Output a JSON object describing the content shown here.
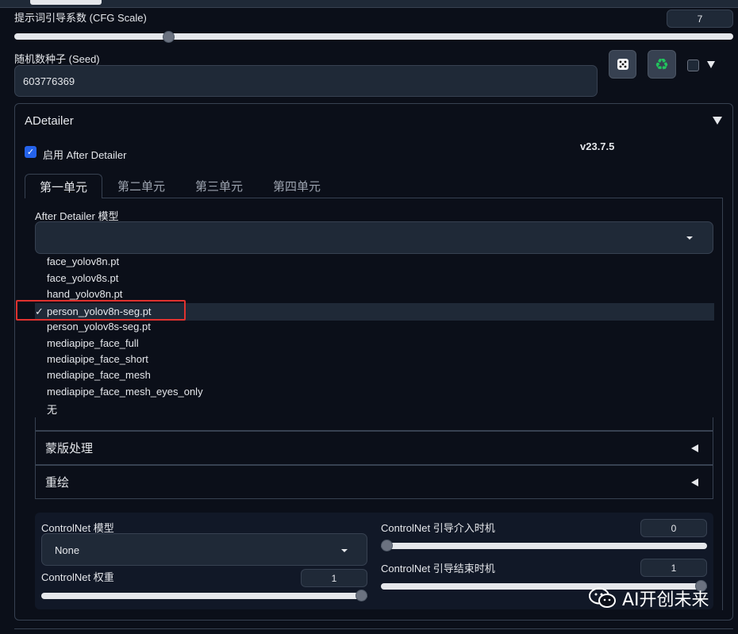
{
  "cfg": {
    "label": "提示词引导系数 (CFG Scale)",
    "value": "7",
    "fraction": 0.21
  },
  "seed": {
    "label": "随机数种子 (Seed)",
    "value": "603776369",
    "dice_icon": "dice-icon",
    "recycle_icon": "recycle-icon"
  },
  "adetailer": {
    "title": "ADetailer",
    "enable_label": "启用 After Detailer",
    "enabled": true,
    "version": "v23.7.5",
    "tabs": [
      "第一单元",
      "第二单元",
      "第三单元",
      "第四单元"
    ],
    "active_tab": 0,
    "model_label": "After Detailer 模型",
    "model_value": "",
    "model_options": [
      "face_yolov8n.pt",
      "face_yolov8s.pt",
      "hand_yolov8n.pt",
      "person_yolov8n-seg.pt",
      "person_yolov8s-seg.pt",
      "mediapipe_face_full",
      "mediapipe_face_short",
      "mediapipe_face_mesh",
      "mediapipe_face_mesh_eyes_only",
      "无"
    ],
    "selected_option": "person_yolov8n-seg.pt",
    "check_mark": "✓",
    "sections": [
      "蒙版处理",
      "重绘"
    ]
  },
  "controlnet": {
    "model_label": "ControlNet 模型",
    "model_value": "None",
    "weight_label": "ControlNet 权重",
    "weight_value": "1",
    "weight_fraction": 1.0,
    "start_label": "ControlNet 引导介入时机",
    "start_value": "0",
    "start_fraction": 0.0,
    "end_label": "ControlNet 引导结束时机",
    "end_value": "1",
    "end_fraction": 1.0
  },
  "watermark": {
    "text": "AI开创未来",
    "icon": "wechat-icon"
  },
  "colors": {
    "accent": "#2563eb",
    "highlight": "#e0322f",
    "background": "#0b0f19"
  }
}
